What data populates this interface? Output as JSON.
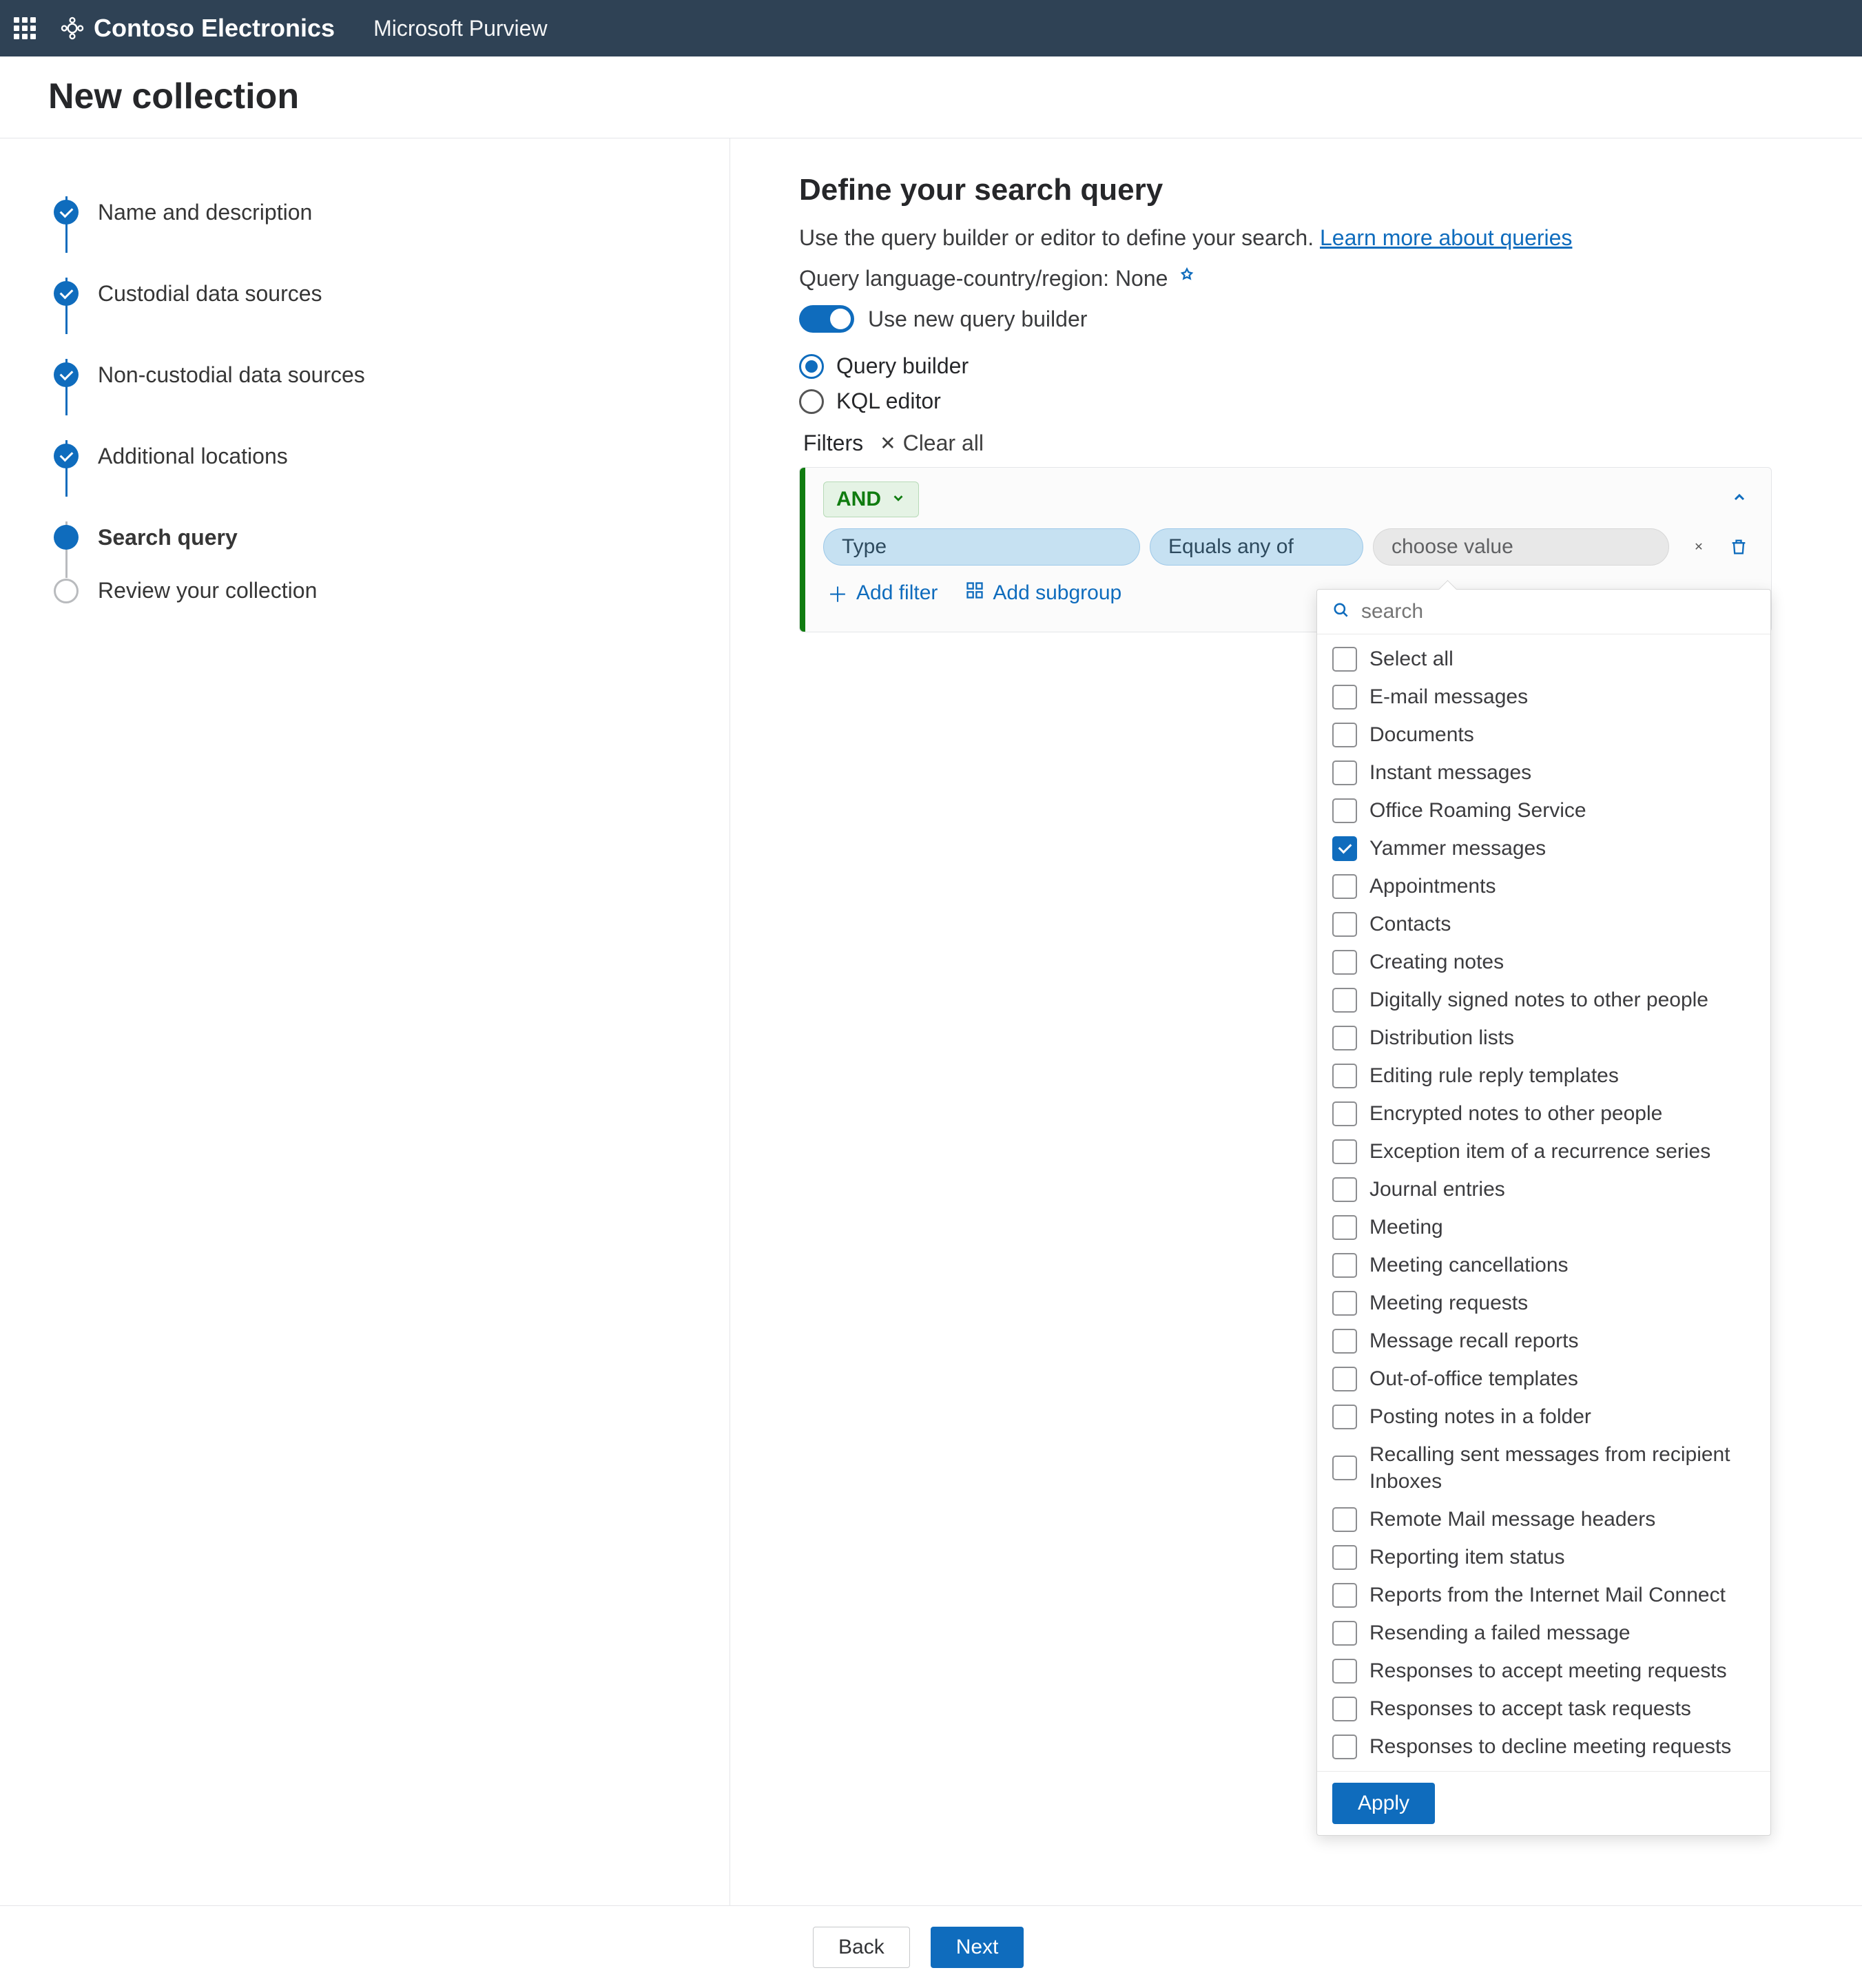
{
  "header": {
    "org_name": "Contoso Electronics",
    "product_name": "Microsoft Purview"
  },
  "page_title": "New collection",
  "steps": [
    {
      "label": "Name and description",
      "state": "done"
    },
    {
      "label": "Custodial data sources",
      "state": "done"
    },
    {
      "label": "Non-custodial data sources",
      "state": "done"
    },
    {
      "label": "Additional locations",
      "state": "done"
    },
    {
      "label": "Search query",
      "state": "current"
    },
    {
      "label": "Review your collection",
      "state": "upcoming"
    }
  ],
  "main": {
    "heading": "Define your search query",
    "subtitle_prefix": "Use the query builder or editor to define your search. ",
    "subtitle_link": "Learn more about queries",
    "locale_label": "Query language-country/region: ",
    "locale_value": "None",
    "toggle_label": "Use new query builder",
    "toggle_on": true,
    "radio_builder": "Query builder",
    "radio_kql": "KQL editor",
    "radio_selected": "builder",
    "filters_label": "Filters",
    "clear_all": "Clear all"
  },
  "query": {
    "group_operator": "AND",
    "filter_field": "Type",
    "filter_operator": "Equals any of",
    "filter_value_placeholder": "choose value",
    "add_filter": "Add filter",
    "add_subgroup": "Add subgroup"
  },
  "dropdown": {
    "search_placeholder": "search",
    "apply_label": "Apply",
    "options": [
      {
        "label": "Select all",
        "checked": false
      },
      {
        "label": "E-mail messages",
        "checked": false
      },
      {
        "label": "Documents",
        "checked": false
      },
      {
        "label": "Instant messages",
        "checked": false
      },
      {
        "label": "Office Roaming Service",
        "checked": false
      },
      {
        "label": "Yammer messages",
        "checked": true
      },
      {
        "label": "Appointments",
        "checked": false
      },
      {
        "label": "Contacts",
        "checked": false
      },
      {
        "label": "Creating notes",
        "checked": false
      },
      {
        "label": "Digitally signed notes to other people",
        "checked": false
      },
      {
        "label": "Distribution lists",
        "checked": false
      },
      {
        "label": "Editing rule reply templates",
        "checked": false
      },
      {
        "label": "Encrypted notes to other people",
        "checked": false
      },
      {
        "label": "Exception item of a recurrence series",
        "checked": false
      },
      {
        "label": "Journal entries",
        "checked": false
      },
      {
        "label": "Meeting",
        "checked": false
      },
      {
        "label": "Meeting cancellations",
        "checked": false
      },
      {
        "label": "Meeting requests",
        "checked": false
      },
      {
        "label": "Message recall reports",
        "checked": false
      },
      {
        "label": "Out-of-office templates",
        "checked": false
      },
      {
        "label": "Posting notes in a folder",
        "checked": false
      },
      {
        "label": "Recalling sent messages from recipient Inboxes",
        "checked": false
      },
      {
        "label": "Remote Mail message headers",
        "checked": false
      },
      {
        "label": "Reporting item status",
        "checked": false
      },
      {
        "label": "Reports from the Internet Mail Connect",
        "checked": false
      },
      {
        "label": "Resending a failed message",
        "checked": false
      },
      {
        "label": "Responses to accept meeting requests",
        "checked": false
      },
      {
        "label": "Responses to accept task requests",
        "checked": false
      },
      {
        "label": "Responses to decline meeting requests",
        "checked": false
      }
    ]
  },
  "footer": {
    "back": "Back",
    "next": "Next"
  }
}
